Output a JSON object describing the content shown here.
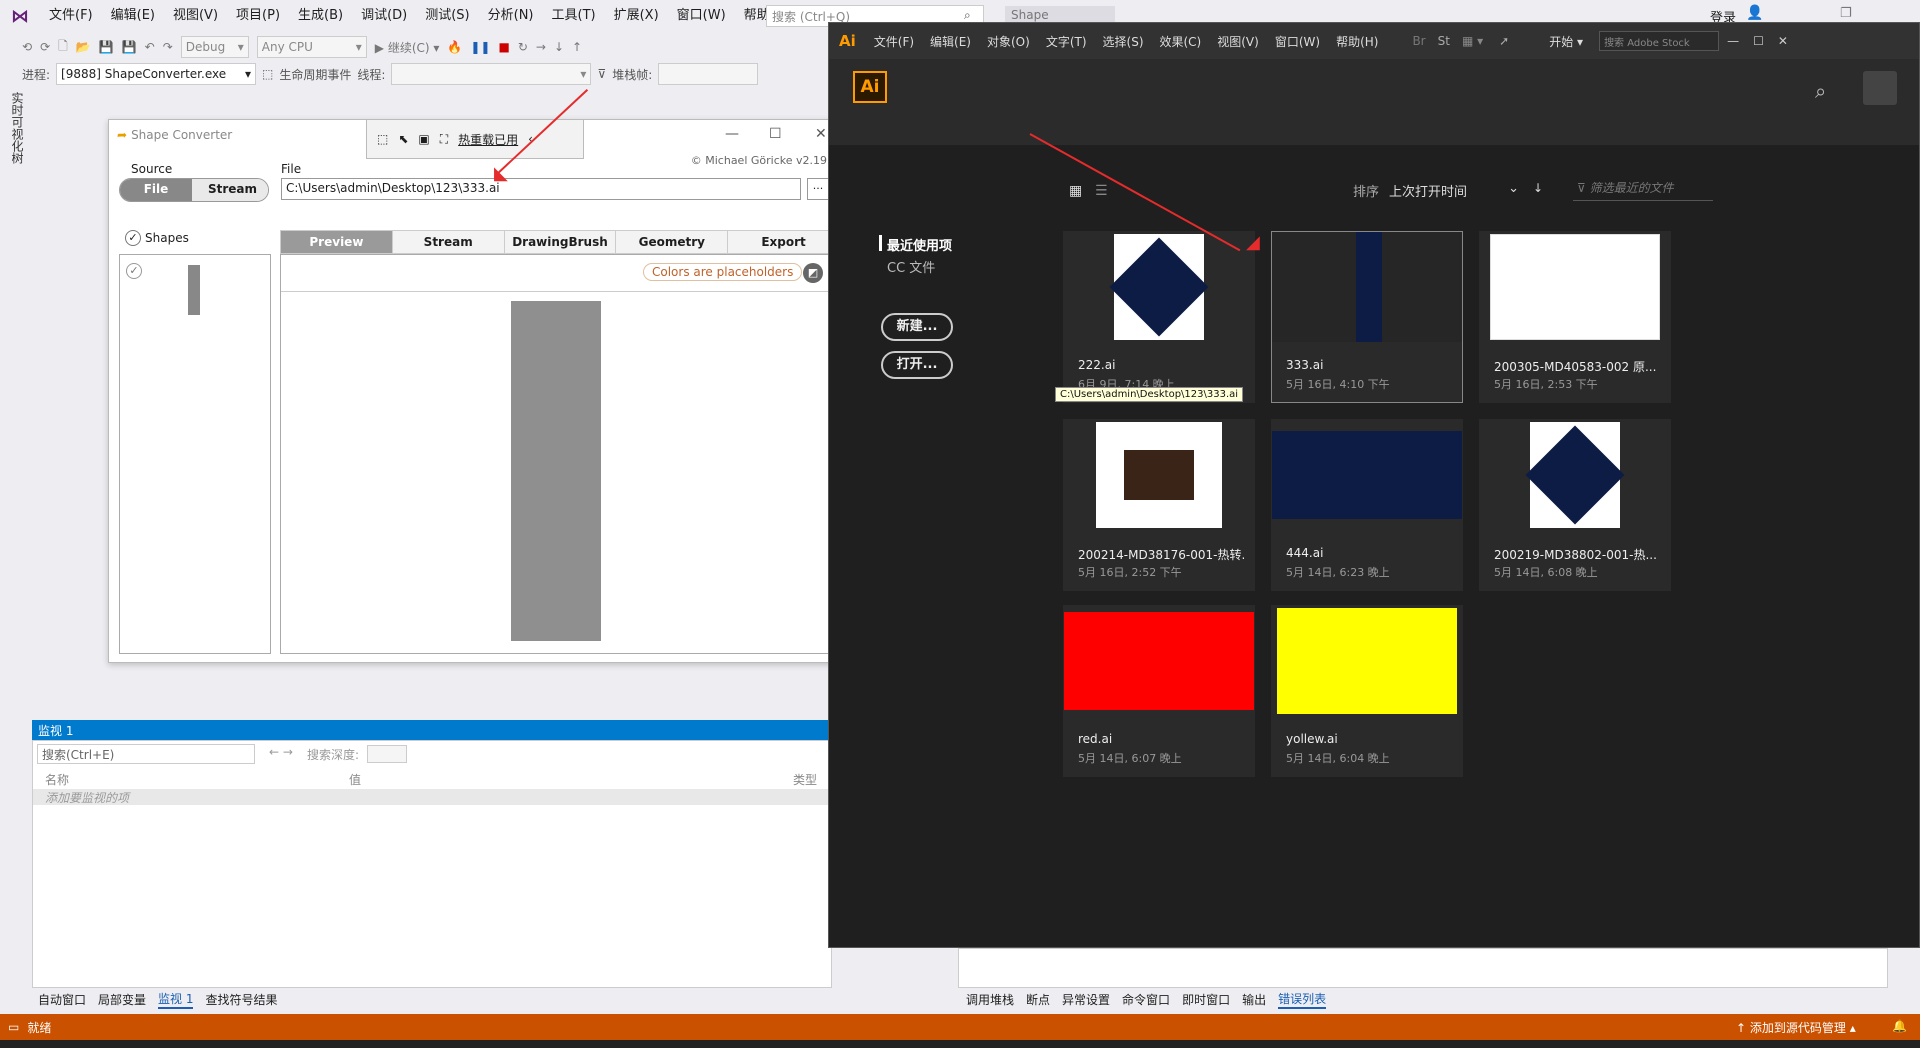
{
  "vs": {
    "menu": [
      "文件(F)",
      "编辑(E)",
      "视图(V)",
      "项目(P)",
      "生成(B)",
      "调试(D)",
      "测试(S)",
      "分析(N)",
      "工具(T)",
      "扩展(X)",
      "窗口(W)",
      "帮助(H)"
    ],
    "search_placeholder": "搜索 (Ctrl+Q)",
    "title_tab": "Shape Converter",
    "login": "登录",
    "config": "Debug",
    "platform": "Any CPU",
    "continue": "继续(C)",
    "process_label": "进程:",
    "process_value": "[9888] ShapeConverter.exe",
    "lifecycle": "生命周期事件",
    "thread_label": "线程:",
    "stackframe_label": "堆栈帧:",
    "side_tab": "实时可视化树",
    "watch": {
      "title": "监视 1",
      "search_placeholder": "搜索(Ctrl+E)",
      "search_depth": "搜索深度:",
      "col_name": "名称",
      "col_value": "值",
      "col_type": "类型",
      "add_hint": "添加要监视的项"
    },
    "bottom_tabs_left": [
      "自动窗口",
      "局部变量",
      "监视 1",
      "查找符号结果"
    ],
    "bottom_tabs_right": [
      "调用堆栈",
      "断点",
      "异常设置",
      "命令窗口",
      "即时窗口",
      "输出",
      "错误列表"
    ],
    "status": "就绪",
    "status_right": "添加到源代码管理"
  },
  "sc": {
    "title": "Shape Converter",
    "hot_reload": "热重载已用",
    "copyright": "© Michael Göricke v2.19",
    "source_label": "Source",
    "file_label": "File",
    "btn_file": "File",
    "btn_stream": "Stream",
    "file_path": "C:\\Users\\admin\\Desktop\\123\\333.ai",
    "browse": "...",
    "shapes_label": "Shapes",
    "tabs": [
      "Preview",
      "Stream",
      "DrawingBrush",
      "Geometry",
      "Export"
    ],
    "placeholder_note": "Colors are placeholders"
  },
  "ai": {
    "logo": "Ai",
    "menu": [
      "文件(F)",
      "编辑(E)",
      "对象(O)",
      "文字(T)",
      "选择(S)",
      "效果(C)",
      "视图(V)",
      "窗口(W)",
      "帮助(H)"
    ],
    "start": "开始",
    "stock_search": "搜索 Adobe Stock",
    "sort_label": "排序",
    "sort_value": "上次打开时间",
    "filter_placeholder": "筛选最近的文件",
    "recent": "最近使用项",
    "cc_files": "CC 文件",
    "new_btn": "新建...",
    "open_btn": "打开...",
    "tooltip": "C:\\Users\\admin\\Desktop\\123\\333.ai",
    "files": [
      {
        "name": "222.ai",
        "date": "6月 9日, 7:14 晚上",
        "thumb": "box-navy"
      },
      {
        "name": "333.ai",
        "date": "5月 16日, 4:10 下午",
        "thumb": "navy-strip"
      },
      {
        "name": "200305-MD40583-002 原...",
        "date": "5月 16日, 2:53 下午",
        "thumb": "document"
      },
      {
        "name": "200214-MD38176-001-热转...",
        "date": "5月 16日, 2:52 下午",
        "thumb": "box-brown"
      },
      {
        "name": "444.ai",
        "date": "5月 14日, 6:23 晚上",
        "thumb": "navy-full"
      },
      {
        "name": "200219-MD38802-001-热...",
        "date": "5月 14日, 6:08 晚上",
        "thumb": "box-navy"
      },
      {
        "name": "red.ai",
        "date": "5月 14日, 6:07 晚上",
        "thumb": "red"
      },
      {
        "name": "yollew.ai",
        "date": "5月 14日, 6:04 晚上",
        "thumb": "yellow"
      }
    ],
    "colors": {
      "accent": "#ff9a00",
      "navy": "#0d1c45",
      "red": "#ff0000",
      "yellow": "#ffff00",
      "annotation": "#e52b2b"
    }
  }
}
